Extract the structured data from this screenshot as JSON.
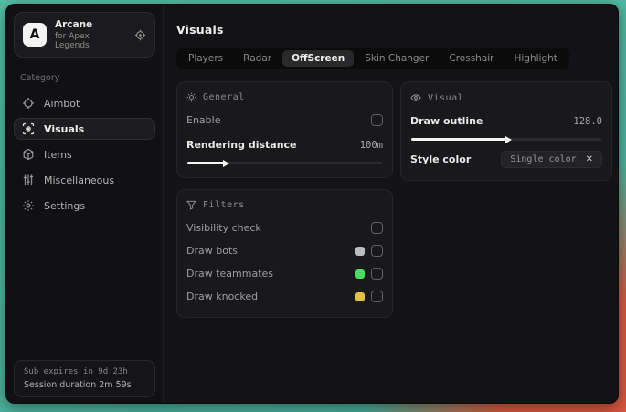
{
  "desktop": {
    "bg_teal": "#4bb39c",
    "bg_red": "#d9583f"
  },
  "sidebar": {
    "logo": {
      "letter": "A",
      "title": "Arcane",
      "subtitle": "for Apex Legends"
    },
    "category_label": "Category",
    "items": [
      {
        "label": "Aimbot",
        "icon": "crosshair-icon",
        "selected": false
      },
      {
        "label": "Visuals",
        "icon": "scan-eye-icon",
        "selected": true
      },
      {
        "label": "Items",
        "icon": "package-icon",
        "selected": false
      },
      {
        "label": "Miscellaneous",
        "icon": "sliders-icon",
        "selected": false
      },
      {
        "label": "Settings",
        "icon": "gear-icon",
        "selected": false
      }
    ],
    "session": {
      "line1": "Sub expires in 9d 23h",
      "line2": "Session duration 2m 59s"
    }
  },
  "header": {
    "title": "Visuals"
  },
  "tabs": [
    {
      "label": "Players",
      "selected": false
    },
    {
      "label": "Radar",
      "selected": false
    },
    {
      "label": "OffScreen",
      "selected": true
    },
    {
      "label": "Skin Changer",
      "selected": false
    },
    {
      "label": "Crosshair",
      "selected": false
    },
    {
      "label": "Highlight",
      "selected": false
    }
  ],
  "general_card": {
    "title": "General",
    "enable_label": "Enable",
    "enable_checked": false,
    "rendering_distance_label": "Rendering distance",
    "rendering_distance_value": "100m",
    "slider_percent": 19
  },
  "filters_card": {
    "title": "Filters",
    "rows": [
      {
        "label": "Visibility check",
        "checked": false
      },
      {
        "label": "Draw bots",
        "swatch": "#b9bcc0",
        "checked": false
      },
      {
        "label": "Draw teammates",
        "swatch": "#4cd964",
        "checked": false
      },
      {
        "label": "Draw knocked",
        "swatch": "#e3c04c",
        "checked": false
      }
    ]
  },
  "visual_card": {
    "title": "Visual",
    "draw_outline_label": "Draw outline",
    "draw_outline_value": "128.0",
    "slider_percent": 50,
    "style_color_label": "Style color",
    "style_color_value": "Single color",
    "style_color_clear": "✕"
  }
}
